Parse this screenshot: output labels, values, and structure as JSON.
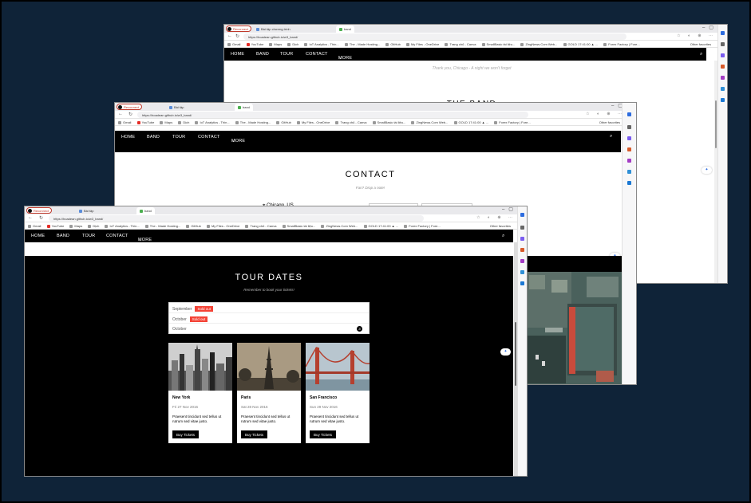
{
  "windows": {
    "back": {
      "profile": "Reconnect",
      "tabs": [
        "Bài tập chương trình",
        "band"
      ],
      "url": "https://hoadean.github.io/w3_band/",
      "bookmarks": [
        "Gmail",
        "YouTube",
        "Maps",
        "Dịch",
        "IoT Analytics - Thin...",
        "The - Made Hosting...",
        "GitHub",
        "My Files - OneDrive",
        "Trang chủ - Canva",
        "SmallBasic tài liệu...",
        "ZingNews.Com Web...",
        "GOLD 17:41:00 ▲ ...",
        "Forex Factory | Fore...",
        "The most care may t..."
      ],
      "other_favorites": "Other favorites",
      "nav": [
        "HOME",
        "BAND",
        "TOUR",
        "CONTACT",
        "MORE"
      ],
      "thanks": "Thank you, Chicago - A night we won't forget",
      "section_title": "THE BAND"
    },
    "middle": {
      "profile": "Reconnect",
      "tabs": [
        "Bài tập",
        "band"
      ],
      "url": "https://hoadean.github.io/w3_band/",
      "bookmarks": [
        "Gmail",
        "YouTube",
        "Maps",
        "Dịch",
        "IoT Analytics - Thin...",
        "The - Made Hosting...",
        "GitHub",
        "My Files - OneDrive",
        "Trang chủ - Canva",
        "SmallBasic tài liệu...",
        "ZingNews.Com Web...",
        "GOLD 17:41:00 ▲ ...",
        "Forex Factory | Fore...",
        "The most care may t..."
      ],
      "other_favorites": "Other favorites",
      "nav": [
        "HOME",
        "BAND",
        "TOUR",
        "CONTACT",
        "MORE"
      ],
      "contact_title": "CONTACT",
      "contact_sub": "Fan? Drop a note!",
      "location": "Chicago, US"
    },
    "front": {
      "profile": "Reconnect",
      "tabs": [
        "Bài tập",
        "band"
      ],
      "url": "https://hoadean.github.io/w3_band/",
      "bookmarks": [
        "Gmail",
        "YouTube",
        "Maps",
        "Dịch",
        "IoT Analytics - Thin...",
        "The - Made Hosting...",
        "GitHub",
        "My Files - OneDrive",
        "Trang chủ - Canva",
        "SmallBasic tài liệu...",
        "ZingNews.Com Web...",
        "GOLD 17:41:00 ▲ ...",
        "Forex Factory | Fore...",
        "The most care may t..."
      ],
      "other_favorites": "Other favorites",
      "nav": [
        "HOME",
        "BAND",
        "TOUR",
        "CONTACT",
        "MORE"
      ],
      "tour": {
        "title": "TOUR DATES",
        "subtitle": "Remember to book your tickets!",
        "months": [
          {
            "name": "September",
            "badge": "Sold out"
          },
          {
            "name": "October",
            "badge": "Sold out"
          },
          {
            "name": "October",
            "count": "3"
          }
        ],
        "cards": [
          {
            "city": "New York",
            "date": "Fri 27 Nov 2016",
            "desc": "Praesent tincidunt sed tellus ut rutrum sed vitae justo.",
            "button": "Buy Tickets"
          },
          {
            "city": "Paris",
            "date": "Sat 28 Nov 2016",
            "desc": "Praesent tincidunt sed tellus ut rutrum sed vitae justo.",
            "button": "Buy Tickets"
          },
          {
            "city": "San Francisco",
            "date": "Sun 29 Nov 2016",
            "desc": "Praesent tincidunt sed tellus ut rutrum sed vitae justo.",
            "button": "Buy Tickets"
          }
        ]
      }
    }
  },
  "colors": {
    "desktop": "#0f2338",
    "nav_bg": "#000000",
    "sold_out": "#f44336",
    "accent": "#2d6cdf"
  },
  "icons": {
    "search": "search-icon",
    "more_caret": "chevron-down-icon",
    "copilot": "copilot-icon"
  }
}
